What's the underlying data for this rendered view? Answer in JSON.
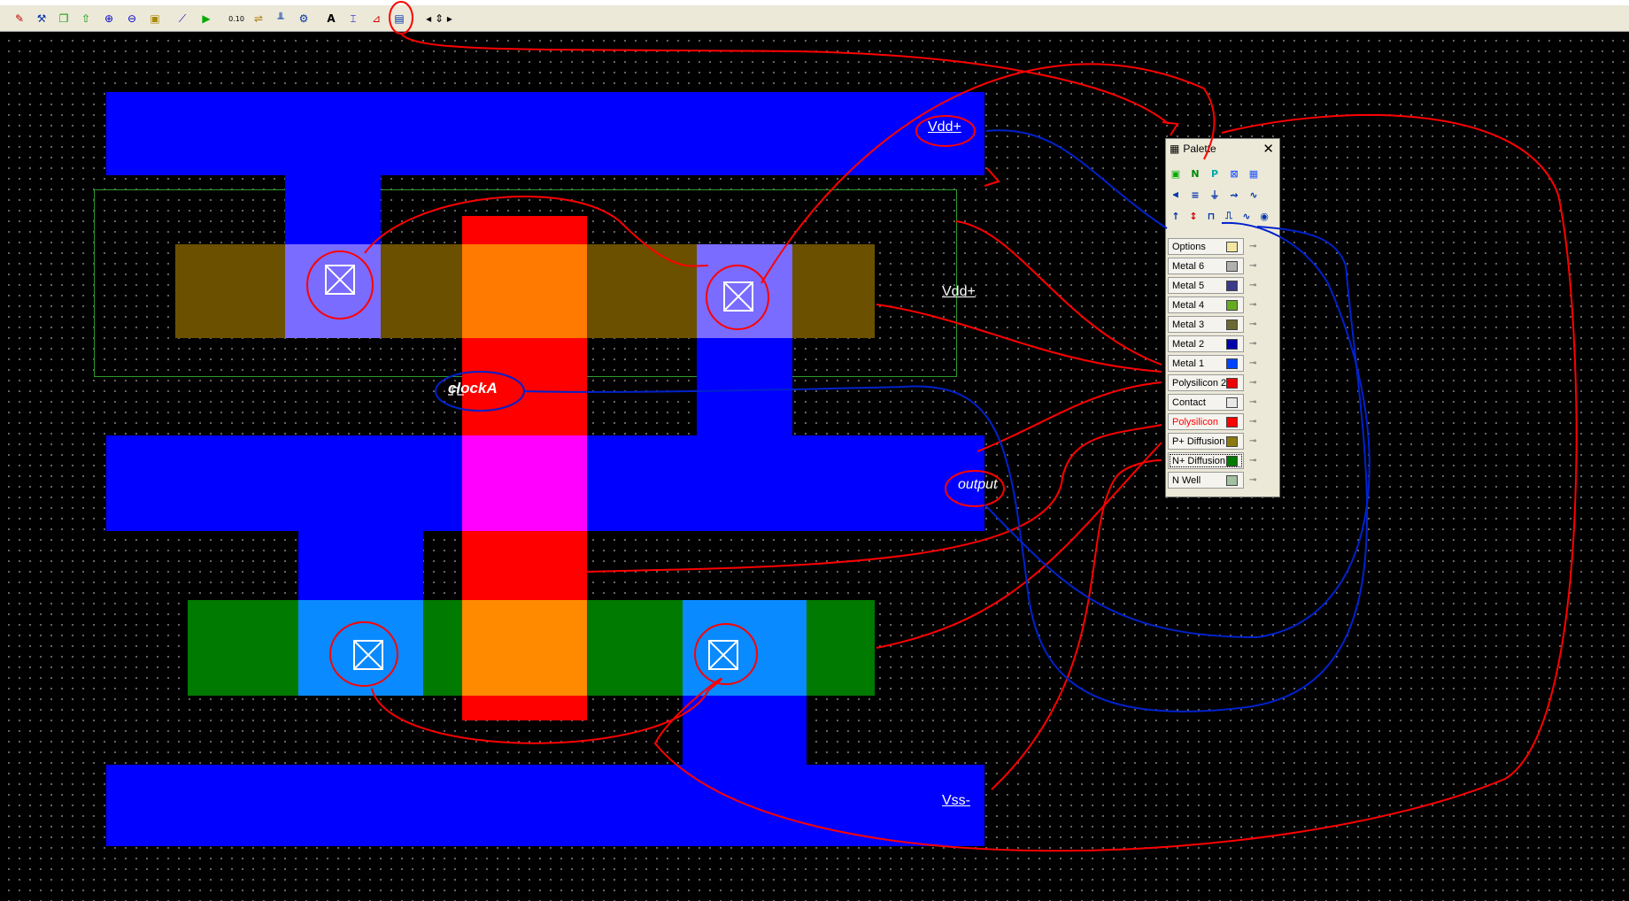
{
  "toolbar": {
    "buttons": [
      {
        "name": "edit-icon",
        "glyph": "✎",
        "color": "#c00000"
      },
      {
        "name": "hammer-icon",
        "glyph": "⚒",
        "color": "#0033aa"
      },
      {
        "name": "copy-icon",
        "glyph": "❐",
        "color": "#009900"
      },
      {
        "name": "flip-icon",
        "glyph": "⇧",
        "color": "#009900"
      },
      {
        "name": "zoom-in-icon",
        "glyph": "⊕",
        "color": "#0000cc"
      },
      {
        "name": "zoom-out-icon",
        "glyph": "⊖",
        "color": "#0000cc"
      },
      {
        "name": "zoom-fit-icon",
        "glyph": "▣",
        "color": "#aa8800"
      },
      {
        "name": "measure-icon",
        "glyph": "⟋",
        "color": "#0000cc"
      },
      {
        "name": "run-icon",
        "glyph": "▶",
        "color": "#00aa00"
      },
      {
        "name": "scale-icon",
        "glyph": "0.10",
        "color": "#000000"
      },
      {
        "name": "route-icon",
        "glyph": "⇌",
        "color": "#aa7700"
      },
      {
        "name": "mos-icon",
        "glyph": "╨",
        "color": "#0033aa"
      },
      {
        "name": "cell-icon",
        "glyph": "⚙",
        "color": "#0033aa"
      },
      {
        "name": "text-icon",
        "glyph": "A",
        "color": "#000000"
      },
      {
        "name": "cross-section-icon",
        "glyph": "⌶",
        "color": "#0000cc"
      },
      {
        "name": "analog-sim-icon",
        "glyph": "⊿",
        "color": "#cc0000"
      },
      {
        "name": "palette-icon",
        "glyph": "▤",
        "color": "#0033aa"
      },
      {
        "name": "nav-arrows-icon",
        "glyph": "◂ ⇕ ▸",
        "color": "#000000"
      }
    ]
  },
  "labels": {
    "vdd_top": "Vdd+",
    "vdd_well": "Vdd+",
    "clock": "clockA",
    "output": "output",
    "vss": "Vss-"
  },
  "palette": {
    "title": "Palette",
    "close": "✕",
    "layers": [
      {
        "label": "Options",
        "swatch": "#f2e6a0",
        "active": false
      },
      {
        "label": "Metal 6",
        "swatch": "#b0b0b0",
        "active": false
      },
      {
        "label": "Metal 5",
        "swatch": "#3a3a8a",
        "active": false
      },
      {
        "label": "Metal 4",
        "swatch": "#66aa22",
        "active": false
      },
      {
        "label": "Metal 3",
        "swatch": "#6a6a30",
        "active": false
      },
      {
        "label": "Metal 2",
        "swatch": "#0000aa",
        "active": false
      },
      {
        "label": "Metal 1",
        "swatch": "#0044ff",
        "active": false
      },
      {
        "label": "Polysilicon 2",
        "swatch": "#ee0000",
        "active": false
      },
      {
        "label": "Contact",
        "swatch": "#e8e8e8",
        "active": false
      },
      {
        "label": "Polysilicon",
        "swatch": "#ff0000",
        "active": true
      },
      {
        "label": "P+ Diffusion",
        "swatch": "#8a7a10",
        "active": false
      },
      {
        "label": "N+ Diffusion",
        "swatch": "#007a00",
        "active": false
      },
      {
        "label": "N Well",
        "swatch": "#a0c0a0",
        "active": false
      }
    ],
    "tool_rows": [
      [
        "nmos-icon",
        "nmos-n-icon",
        "pmos-icon",
        "contact-icon",
        "via-icon"
      ],
      [
        "resistor-icon",
        "capacitor-icon",
        "ground-icon",
        "diode-icon",
        "inductor-icon"
      ],
      [
        "vdd-icon",
        "vss-icon",
        "clock-icon",
        "pulse-icon",
        "sine-icon",
        "eye-icon"
      ]
    ]
  },
  "colors": {
    "metal1": "#0000ff",
    "polysilicon": "#ff0000",
    "p_diffusion": "#6b5000",
    "n_diffusion": "#007a00",
    "annotation_red": "#ff0000",
    "annotation_blue": "#0022cc"
  }
}
